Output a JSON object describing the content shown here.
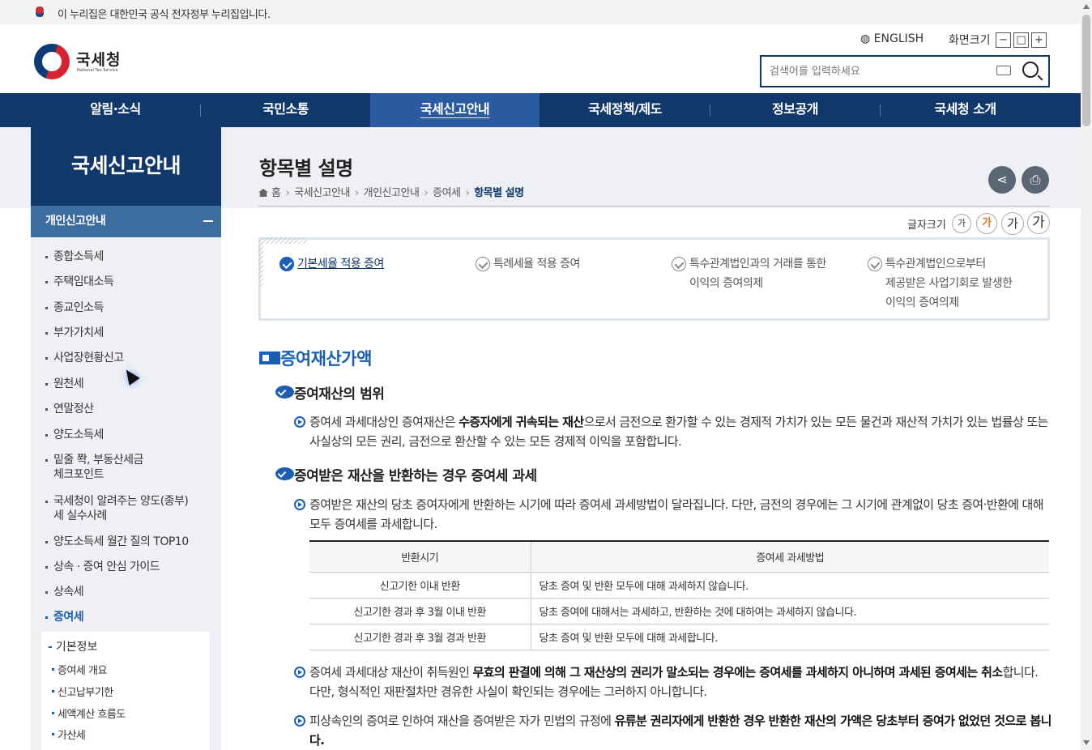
{
  "gov_banner": {
    "text": "이 누리집은 대한민국 공식 전자정부 누리집입니다."
  },
  "logo": {
    "ko": "국세청",
    "en": "National Tax Service"
  },
  "header": {
    "english": "ENGLISH",
    "screen_size_label": "화면크기",
    "zoom_out": "−",
    "zoom_reset": "□",
    "zoom_in": "+",
    "search_placeholder": "검색어를 입력하세요"
  },
  "gnb": [
    "알림·소식",
    "국민소통",
    "국세신고안내",
    "국세정책/제도",
    "정보공개",
    "국세청 소개"
  ],
  "gnb_active": "국세신고안내",
  "lnb": {
    "title": "국세신고안내",
    "section": "개인신고안내",
    "items": [
      "종합소득세",
      "주택임대소득",
      "종교인소득",
      "부가가치세",
      "사업장현황신고",
      "원천세",
      "연말정산",
      "양도소득세",
      "밑줄 쫙, 부동산세금",
      "체크포인트",
      "국세청이 알려주는 양도(종부)",
      "세 실수사례",
      "양도소득세 월간 질의 TOP10",
      "상속 · 증여 안심 가이드",
      "상속세",
      "증여세"
    ],
    "sub_header": "기본정보",
    "sub_items": [
      "증여세 개요",
      "신고납부기한",
      "세액계산 흐름도",
      "가산세"
    ]
  },
  "page": {
    "title": "항목별 설명",
    "breadcrumb": [
      "홈",
      "국세신고안내",
      "개인신고안내",
      "증여세",
      "항목별 설명"
    ],
    "share_icon": "share-icon",
    "print_icon": "print-icon",
    "font_size_label": "글자크기",
    "font_sizes": [
      "가",
      "가",
      "가",
      "가"
    ]
  },
  "tabs": [
    {
      "label": "기본세율 적용 증여",
      "active": true
    },
    {
      "label": "특례세율 적용 증여",
      "active": false
    },
    {
      "line1": "특수관계법인과의 거래를 통한",
      "line2": "이익의 증여의제",
      "active": false
    },
    {
      "line1": "특수관계법인으로부터",
      "line2": "제공받은 사업기회로 발생한",
      "line3": "이익의 증여의제",
      "active": false
    }
  ],
  "content": {
    "section_title": "증여재산가액",
    "sub1": "증여재산의 범위",
    "p1_a": "증여세 과세대상인 증여재산은 ",
    "p1_b": "수증자에게 귀속되는 재산",
    "p1_c": "으로서 금전으로 환가할 수 있는 경제적 가치가 있는 모든 물건과 재산적 가치가 있는 법률상 또는 사실상의 모든 권리, 금전으로 환산할 수 있는 모든 경제적 이익을 포함합니다.",
    "sub2": "증여받은 재산을 반환하는 경우 증여세 과세",
    "p2": "증여받은 재산의 당초 증여자에게 반환하는 시기에 따라 증여세 과세방법이 달라집니다. 다만, 금전의 경우에는 그 시기에 관계없이 당초 증여·반환에 대해 모두 증여세를 과세합니다.",
    "table": {
      "headers": [
        "반환시기",
        "증여세 과세방법"
      ],
      "rows": [
        [
          "신고기한 이내 반환",
          "당초 증여 및 반환 모두에 대해 과세하지 않습니다."
        ],
        [
          "신고기한 경과 후 3월 이내 반환",
          "당초 증여에 대해서는 과세하고, 반환하는 것에 대하여는 과세하지 않습니다."
        ],
        [
          "신고기한 경과 후 3월 경과 반환",
          "당초 증여 및 반환 모두에 대해 과세합니다."
        ]
      ]
    },
    "p3_a": "증여세 과세대상 재산이 취득원인 ",
    "p3_b": "무효의 판결에 의해 그 재산상의 권리가 말소되는 경우에는 증여세를 과세하지 아니하며 과세된 증여세는 취소",
    "p3_c": "합니다. 다만, 형식적인 재판절차만 경유한 사실이 확인되는 경우에는 그러하지 아니합니다.",
    "p4_a": "피상속인의 증여로 인하여 재산을 증여받은 자가 민법의 규정에 ",
    "p4_b": "유류분 권리자에게 반환한 경우 반환한 재산의 가액은 당초부터 증여가 없었던 것으로 봅니다."
  }
}
